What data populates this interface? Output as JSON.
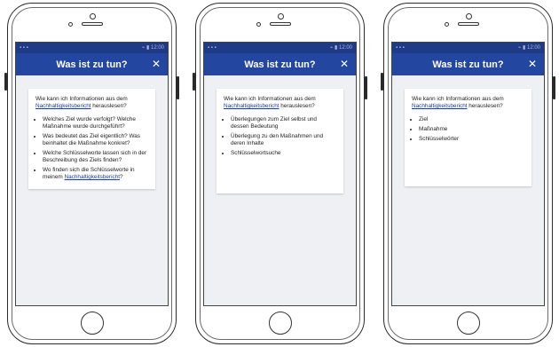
{
  "phones": [
    {
      "status": {
        "left": "▪ ▪ ▪",
        "right": "⌁ ▮ 12:00"
      },
      "header": {
        "title": "Was ist zu tun?",
        "close_icon": "close-icon"
      },
      "intro": {
        "text": "Wie kann ich Informationen aus dem",
        "link": "Nachhaltigkeitsbericht",
        "suffix": " herauslesen?"
      },
      "items": [
        {
          "text": "Welches Ziel wurde verfolgt? Welche Maßnahme wurde durchgeführt?"
        },
        {
          "text": "Was bedeutet das Ziel eigentlich? Was beinhaltet die Maßnahme konkret?"
        },
        {
          "text": "Welche Schlüsselworte lassen sich in der Beschreibung des Ziels finden?"
        },
        {
          "text": "Wo finden sich die Schlüsselworte in meinem ",
          "link": "Nachhaltigkeitsbericht",
          "suffix": "?"
        }
      ]
    },
    {
      "status": {
        "left": "▪ ▪ ▪",
        "right": "⌁ ▮ 12:00"
      },
      "header": {
        "title": "Was ist zu tun?",
        "close_icon": "close-icon"
      },
      "intro": {
        "text": "Wie kann ich Informationen aus dem",
        "link": "Nachhaltigkeitsbericht",
        "suffix": " herauslesen?"
      },
      "items": [
        {
          "text": "Überlegungen zum Ziel selbst und dessen Bedeutung"
        },
        {
          "text": "Überlegung zu den Maßnahmen und deren Inhalte"
        },
        {
          "text": "Schlüsselwortsuche"
        }
      ]
    },
    {
      "status": {
        "left": "▪ ▪ ▪",
        "right": "⌁ ▮ 12:00"
      },
      "header": {
        "title": "Was ist zu tun?",
        "close_icon": "close-icon"
      },
      "intro": {
        "text": "Wie kann ich Informationen aus dem",
        "link": "Nachhaltigkeitsbericht",
        "suffix": " herauslesen?"
      },
      "items": [
        {
          "text": "Ziel"
        },
        {
          "text": "Maßnahme"
        },
        {
          "text": "Schlüsselwörter"
        }
      ]
    }
  ],
  "colors": {
    "appbar": "#2347a0",
    "statusbar": "#1f3a86",
    "link": "#1a3c9c",
    "screen_bg": "#eef0f3"
  }
}
